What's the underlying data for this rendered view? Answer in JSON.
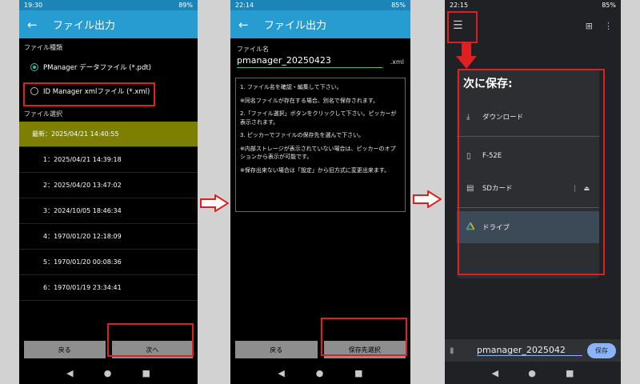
{
  "phone1": {
    "status": {
      "time": "19:30",
      "battery": "89%"
    },
    "title": "ファイル出力",
    "file_type_label": "ファイル種類",
    "radio_options": [
      "PManager データファイル (*.pdt)",
      "ID Manager xmlファイル (*.xml)"
    ],
    "file_select_label": "ファイル選択",
    "files": [
      "最新：2025/04/21 14:40:55",
      "1：2025/04/21 14:39:18",
      "2：2025/04/20 13:47:02",
      "3：2024/10/05 18:46:34",
      "4：1970/01/20 12:18:09",
      "5：1970/01/20 00:08:36",
      "6：1970/01/19 23:34:41"
    ],
    "back_button": "戻る",
    "next_button": "次へ"
  },
  "phone2": {
    "status": {
      "time": "22:14",
      "battery": "85%"
    },
    "title": "ファイル出力",
    "filename_label": "ファイル名",
    "filename": "pmanager_20250423",
    "extension": ".xml",
    "instructions": [
      "1. ファイル名を確認・編集して下さい。",
      "※同名ファイルが存在する場合、別名で保存されます。",
      "2.「ファイル選択」ボタンをクリックして下さい。ピッカーが表示されます。",
      "3. ピッカーでファイルの保存先を選んで下さい。",
      "※内部ストレージが表示されていない場合は、ピッカーのオプションから表示が可能です。",
      "※保存出来ない場合は「設定」から旧方式に変更出来ます。"
    ],
    "back_button": "戻る",
    "select_dest_button": "保存先選択"
  },
  "phone3": {
    "status": {
      "time": "22:15",
      "battery": "85%"
    },
    "drawer_title": "次に保存:",
    "items": {
      "download": "ダウンロード",
      "device": "F-52E",
      "sdcard": "SDカード",
      "drive": "ドライブ"
    },
    "filename": "pmanager_2025042",
    "save_button": "保存"
  },
  "colors": {
    "highlight": "#e02020",
    "appbar": "#279cd0",
    "selected_row": "#7c7f00",
    "save_button": "#8ab4f8"
  }
}
